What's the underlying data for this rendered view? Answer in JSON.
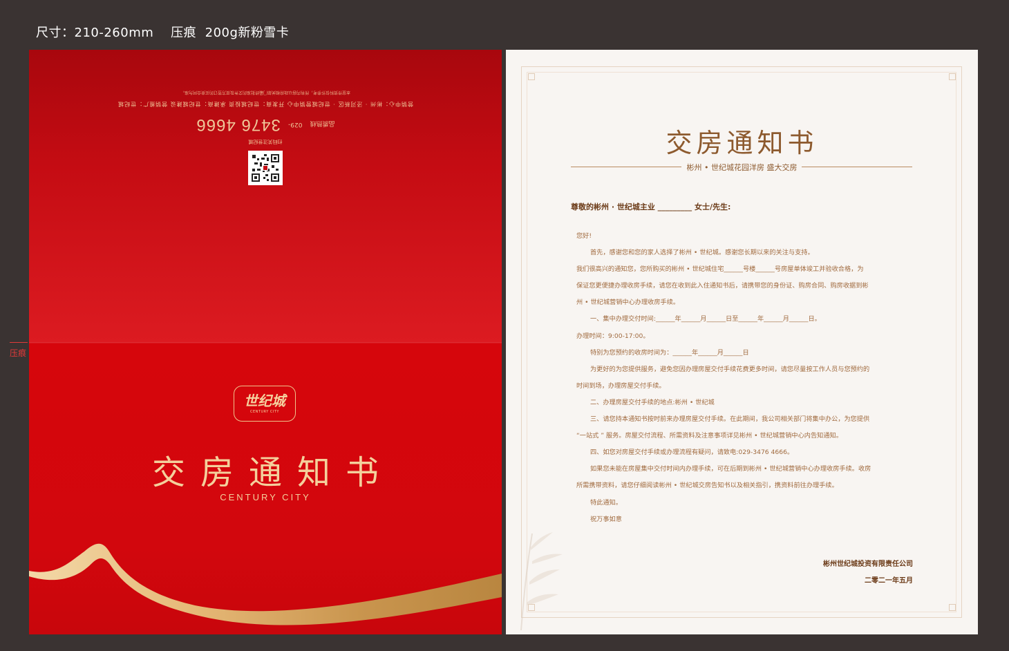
{
  "spec": {
    "size_label": "尺寸：210-260mm",
    "crease_label": "压痕",
    "paper_label": "200g新粉雪卡"
  },
  "crease_mark": "压痕",
  "cover": {
    "logo_text": "世纪城",
    "logo_sub": "CENTURY CITY",
    "title": "交房通知书",
    "subtitle": "CENTURY CITY",
    "back": {
      "hotline_label": "品质热线",
      "hotline_prefix": "029-",
      "hotline_number": "3476 4666",
      "qr_caption": "扫码关注世纪城",
      "address": "营销中心：彬州 · 泾河新区 · 世纪城营销中心   开发商：世纪城投资   承建商：世纪城建设   营销推广：世纪城",
      "disclaimer": "本宣传资料仅作参考，所有内容以政府相关部门最终批准的文件及双方签订的买卖合同为准。"
    },
    "colors": {
      "red": "#d6060c",
      "gold": "#f4d09c"
    }
  },
  "letter": {
    "title": "交房通知书",
    "subtitle": "彬州 • 世纪城花园洋房 盛大交房",
    "salutation": "尊敬的彬州 · 世纪城主业 _________ 女士/先生:",
    "lines": [
      "您好!",
      "首先，感谢您和您的家人选择了彬州 • 世纪城。感谢您长期以来的关注与支持。",
      "我们很高兴的通知您，您所购买的彬州 • 世纪城住宅______号楼______号房屋单体竣工并验收合格，为",
      "保证您更便捷办理收房手续，请您在收到此入住通知书后，请携带您的身份证、购房合同、购房收据到彬",
      "州 • 世纪城营销中心办理收房手续。",
      "一、集中办理交付时间:______年______月______日至______年______月______日。",
      "办理时间：9:00-17:00。",
      "特别为您预约的收房时间为：______年______月______日",
      "为更好的为您提供服务，避免您因办理房屋交付手续花费更多时间，请您尽量按工作人员与您预约的",
      "时间到场，办理房屋交付手续。",
      "二、办理房屋交付手续的地点:彬州 • 世纪城",
      "三、请您持本通知书按时前来办理房屋交付手续。在此期间，我公司相关部门将集中办公，为您提供",
      "“一站式 ” 服务。房屋交付流程、所需资料及注意事项详见彬州 • 世纪城营销中心内告知通知。",
      "四、如您对房屋交付手续或办理流程有疑问，请致电:029-3476  4666。",
      "如果您未能在房屋集中交付时间内办理手续，可在后期到彬州 • 世纪城营销中心办理收房手续。收房",
      "所需携带资料，请您仔细阅读彬州 • 世纪城交房告知书以及相关指引，携资料前往办理手续。",
      "特此通知。",
      "祝万事如意"
    ],
    "company": "彬州世纪城投资有限责任公司",
    "date": "二零二一年五月",
    "colors": {
      "title": "#8d5a2e",
      "body": "#a06a3e",
      "paper": "#f8f5f2"
    }
  }
}
